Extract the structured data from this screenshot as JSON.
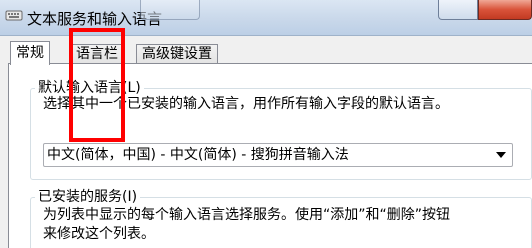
{
  "window": {
    "title": "文本服务和输入语言",
    "app_icon": "keyboard-icon"
  },
  "tabs": [
    {
      "label": "常规",
      "active": true
    },
    {
      "label": "语言栏",
      "active": false
    },
    {
      "label": "高级键设置",
      "active": false
    }
  ],
  "default_language": {
    "legend": "默认输入语言(L)",
    "description": "选择其中一个已安装的输入语言，用作所有输入字段的默认语言。",
    "selected": "中文(简体，中国) - 中文(简体) - 搜狗拼音输入法"
  },
  "installed_services": {
    "legend": "已安装的服务(I)",
    "description_line1": "为列表中显示的每个输入语言选择服务。使用“添加”和“删除”按钮",
    "description_line2": "来修改这个列表。"
  },
  "colors": {
    "annotation": "#ff0000",
    "close_button": "#c23a22"
  }
}
